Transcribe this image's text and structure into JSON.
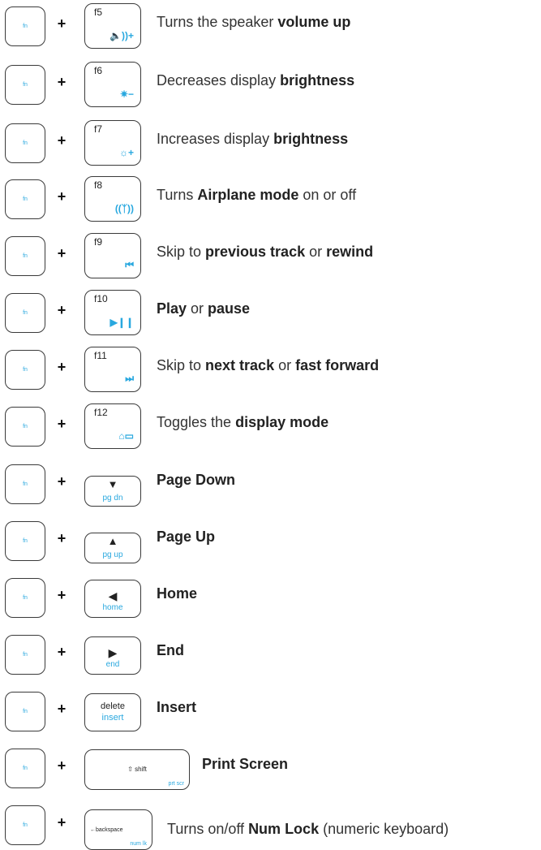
{
  "fn_label": "fn",
  "plus": "+",
  "rows": [
    {
      "key_type": "f",
      "fnum": "f5",
      "icon": "🔈))+",
      "icon_name": "speaker-volume-up-icon",
      "desc": [
        {
          "t": "Turns the speaker "
        },
        {
          "t": "volume up",
          "b": true
        }
      ]
    },
    {
      "key_type": "f",
      "fnum": "f6",
      "icon": "✷−",
      "icon_name": "brightness-down-icon",
      "desc": [
        {
          "t": "Decreases display "
        },
        {
          "t": "brightness",
          "b": true
        }
      ]
    },
    {
      "key_type": "f",
      "fnum": "f7",
      "icon": "☼+",
      "icon_name": "brightness-up-icon",
      "desc": [
        {
          "t": "Increases display "
        },
        {
          "t": "brightness",
          "b": true
        }
      ]
    },
    {
      "key_type": "f",
      "fnum": "f8",
      "icon": "((ᛉ))",
      "icon_name": "airplane-mode-icon",
      "desc": [
        {
          "t": "Turns "
        },
        {
          "t": "Airplane mode",
          "b": true
        },
        {
          "t": " on or off"
        }
      ]
    },
    {
      "key_type": "f",
      "fnum": "f9",
      "icon": "⏮",
      "icon_name": "previous-track-icon",
      "desc": [
        {
          "t": "Skip to "
        },
        {
          "t": "previous track",
          "b": true
        },
        {
          "t": " or "
        },
        {
          "t": "rewind",
          "b": true
        }
      ]
    },
    {
      "key_type": "f",
      "fnum": "f10",
      "icon": "▶❙❙",
      "icon_name": "play-pause-icon",
      "desc": [
        {
          "t": "Play",
          "b": true
        },
        {
          "t": " or "
        },
        {
          "t": "pause",
          "b": true
        }
      ]
    },
    {
      "key_type": "f",
      "fnum": "f11",
      "icon": "⏭",
      "icon_name": "next-track-icon",
      "desc": [
        {
          "t": "Skip to "
        },
        {
          "t": "next track",
          "b": true
        },
        {
          "t": " or "
        },
        {
          "t": "fast forward",
          "b": true
        }
      ]
    },
    {
      "key_type": "f",
      "fnum": "f12",
      "icon": "⌂▭",
      "icon_name": "display-mode-icon",
      "desc": [
        {
          "t": "Toggles the "
        },
        {
          "t": "display mode",
          "b": true
        }
      ]
    },
    {
      "key_type": "nav",
      "arrow": "▼",
      "sub": "pg dn",
      "icon_name": "arrow-down-icon",
      "desc": [
        {
          "t": "Page Down",
          "b": true
        }
      ]
    },
    {
      "key_type": "nav",
      "arrow": "▲",
      "sub": "pg up",
      "icon_name": "arrow-up-icon",
      "desc": [
        {
          "t": "Page Up",
          "b": true
        }
      ]
    },
    {
      "key_type": "side",
      "arrow": "◀",
      "sub": "home",
      "icon_name": "arrow-left-icon",
      "desc": [
        {
          "t": "Home",
          "b": true
        }
      ]
    },
    {
      "key_type": "side",
      "arrow": "▶",
      "sub": "end",
      "icon_name": "arrow-right-icon",
      "desc": [
        {
          "t": "End",
          "b": true
        }
      ]
    },
    {
      "key_type": "delete",
      "top": "delete",
      "sub": "insert",
      "desc": [
        {
          "t": "Insert",
          "b": true
        }
      ]
    },
    {
      "key_type": "shift",
      "top": "⇧ shift",
      "sub": "prt scr",
      "desc": [
        {
          "t": "Print Screen",
          "b": true
        }
      ]
    },
    {
      "key_type": "backspace",
      "top": "←backspace",
      "sub": "num lk",
      "desc": [
        {
          "t": "Turns on/off "
        },
        {
          "t": "Num Lock",
          "b": true
        },
        {
          "t": " (numeric keyboard)"
        }
      ]
    }
  ]
}
